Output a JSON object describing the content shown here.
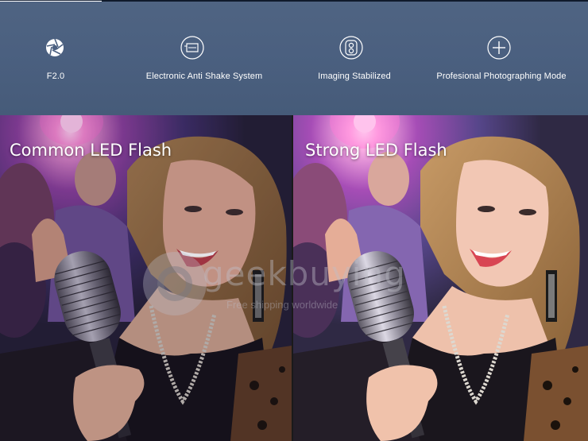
{
  "features": [
    {
      "label": "F2.0",
      "icon": "aperture-icon"
    },
    {
      "label": "Electronic Anti Shake System",
      "icon": "anti-shake-icon"
    },
    {
      "label": "Imaging Stabilized",
      "icon": "stabilizer-icon"
    },
    {
      "label": "Profesional Photographing Mode",
      "icon": "plus-circle-icon"
    }
  ],
  "comparison": {
    "left_title": "Common LED Flash",
    "right_title": "Strong LED Flash"
  },
  "watermark": {
    "brand": "geekbuying",
    "tagline": "Free shipping worldwide"
  },
  "colors": {
    "banner": "#4b6080",
    "text": "#ffffff"
  }
}
